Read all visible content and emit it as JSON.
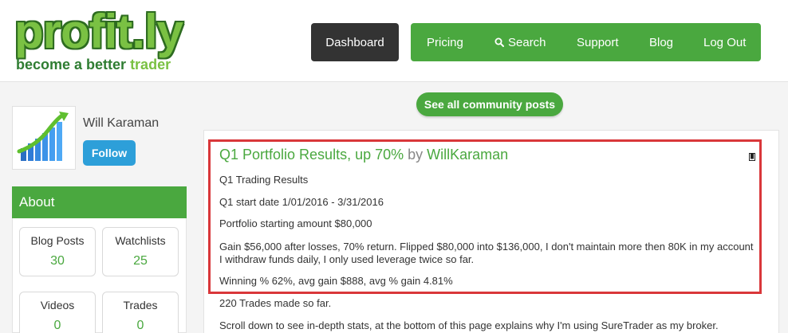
{
  "logo": {
    "word": "profit.ly",
    "tagline_part1": "become a better ",
    "tagline_part2": "trader"
  },
  "nav": {
    "dashboard": "Dashboard",
    "pricing": "Pricing",
    "search": "Search",
    "support": "Support",
    "blog": "Blog",
    "logout": "Log Out"
  },
  "community_button": "See all community posts",
  "profile": {
    "name": "Will Karaman",
    "follow": "Follow"
  },
  "about": {
    "title": "About",
    "stats": [
      {
        "label": "Blog Posts",
        "value": "30"
      },
      {
        "label": "Watchlists",
        "value": "25"
      },
      {
        "label": "Videos",
        "value": "0"
      },
      {
        "label": "Trades",
        "value": "0"
      }
    ]
  },
  "post": {
    "title": "Q1 Portfolio Results, up 70%",
    "by": "by",
    "author": "WillKaraman",
    "paragraphs": [
      "Q1 Trading Results",
      "Q1 start date 1/01/2016 - 3/31/2016",
      "Portfolio starting amount $80,000",
      "Gain $56,000 after losses, 70% return. Flipped $80,000 into $136,000, I don't maintain more then 80K in my account I withdraw funds daily, I only used leverage twice so far.",
      "Winning % 62%, avg gain $888, avg % gain 4.81%",
      "220 Trades made so far.",
      "Scroll down to see in-depth stats, at the bottom of this page explains why I'm using SureTrader as my broker."
    ]
  },
  "colors": {
    "brand_green": "#4aa83f",
    "dark": "#333333",
    "follow_blue": "#2d9fd9",
    "highlight_red": "#d9373a"
  }
}
